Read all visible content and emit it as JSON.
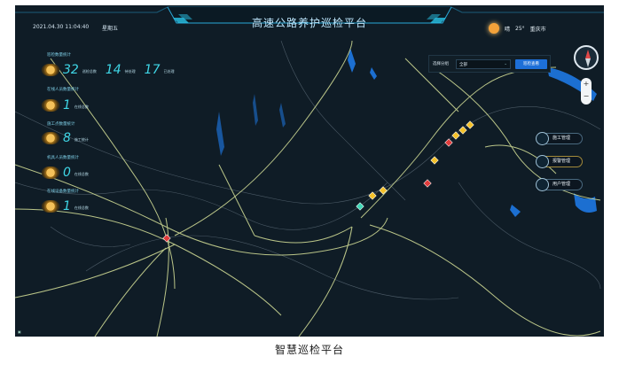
{
  "header": {
    "datetime": "2021.04.30 11:04:40",
    "weekday": "星期五",
    "title": "高速公路养护巡检平台",
    "weather": {
      "condition": "晴",
      "temperature": "25°",
      "city": "重庆市"
    }
  },
  "stats": {
    "patrol_group_label": "巡检数量统计",
    "patrol_total": "32",
    "patrol_total_label": "巡检总数",
    "patrol_pending": "14",
    "patrol_pending_label": "待处理",
    "patrol_done": "17",
    "patrol_done_label": "已处理",
    "online_group_label": "在线人员数量统计",
    "online_count": "1",
    "online_label": "在线总数",
    "construction_group_label": "施工点数量统计",
    "construction_count": "8",
    "construction_label": "施工统计",
    "vehicle_group_label": "机具人员数量统计",
    "vehicle_count": "0",
    "vehicle_label": "在线总数",
    "device_group_label": "在线设备数量统计",
    "device_count": "1",
    "device_label": "在线总数"
  },
  "filter": {
    "label": "选择分组",
    "selected": "全部",
    "button": "巡检查看"
  },
  "legend": {
    "items": [
      {
        "label": "施工管理",
        "icon": "construction-icon"
      },
      {
        "label": "报警管理",
        "icon": "alarm-icon"
      },
      {
        "label": "用户管理",
        "icon": "user-icon"
      }
    ]
  },
  "map": {
    "zoom_in": "+",
    "zoom_out": "−"
  },
  "colors": {
    "background": "#0f1c26",
    "road": "#d8e39a",
    "water": "#1c6fd1",
    "accent": "#3fd6e6"
  },
  "footer": {
    "caption": "智慧巡检平台"
  }
}
